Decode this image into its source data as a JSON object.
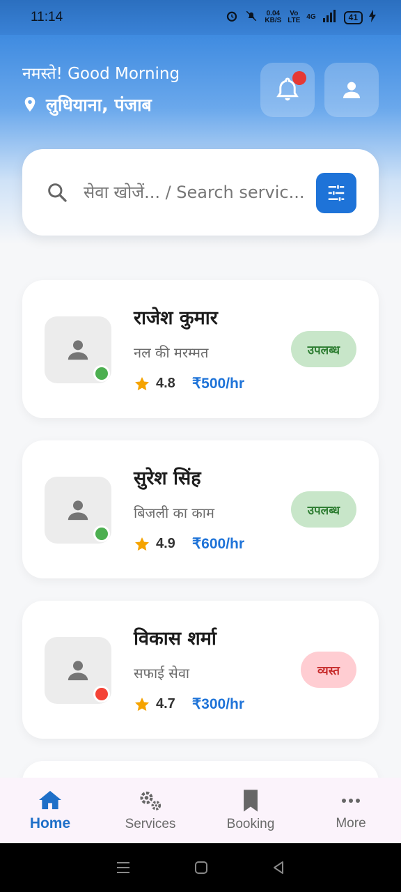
{
  "status_bar": {
    "time": "11:14",
    "net_speed_value": "0.04",
    "net_speed_unit": "KB/S",
    "volte": "Vo LTE",
    "network": "4G",
    "battery": "41"
  },
  "header": {
    "greeting": "नमस्ते! Good Morning",
    "location": "लुधियाना, पंजाब",
    "icons": {
      "bell": "bell-icon",
      "profile": "person-icon",
      "pin": "location-pin-icon"
    }
  },
  "search": {
    "placeholder": "सेवा खोजें... / Search servic..."
  },
  "providers": [
    {
      "name": "राजेश कुमार",
      "service": "नल की मरम्मत",
      "rating": "4.8",
      "price": "₹500/hr",
      "status": "उपलब्ध",
      "state": "available"
    },
    {
      "name": "सुरेश सिंह",
      "service": "बिजली का काम",
      "rating": "4.9",
      "price": "₹600/hr",
      "status": "उपलब्ध",
      "state": "available"
    },
    {
      "name": "विकास शर्मा",
      "service": "सफाई सेवा",
      "rating": "4.7",
      "price": "₹300/hr",
      "status": "व्यस्त",
      "state": "busy"
    }
  ],
  "colors": {
    "accent": "#1e73d8",
    "online": "#4caf50",
    "offline": "#f44336",
    "star": "#f5a300"
  },
  "bottom_nav": {
    "items": [
      {
        "label": "Home",
        "icon": "home-icon",
        "active": true
      },
      {
        "label": "Services",
        "icon": "gears-icon",
        "active": false
      },
      {
        "label": "Booking",
        "icon": "bookmark-icon",
        "active": false
      },
      {
        "label": "More",
        "icon": "more-dots-icon",
        "active": false
      }
    ]
  }
}
